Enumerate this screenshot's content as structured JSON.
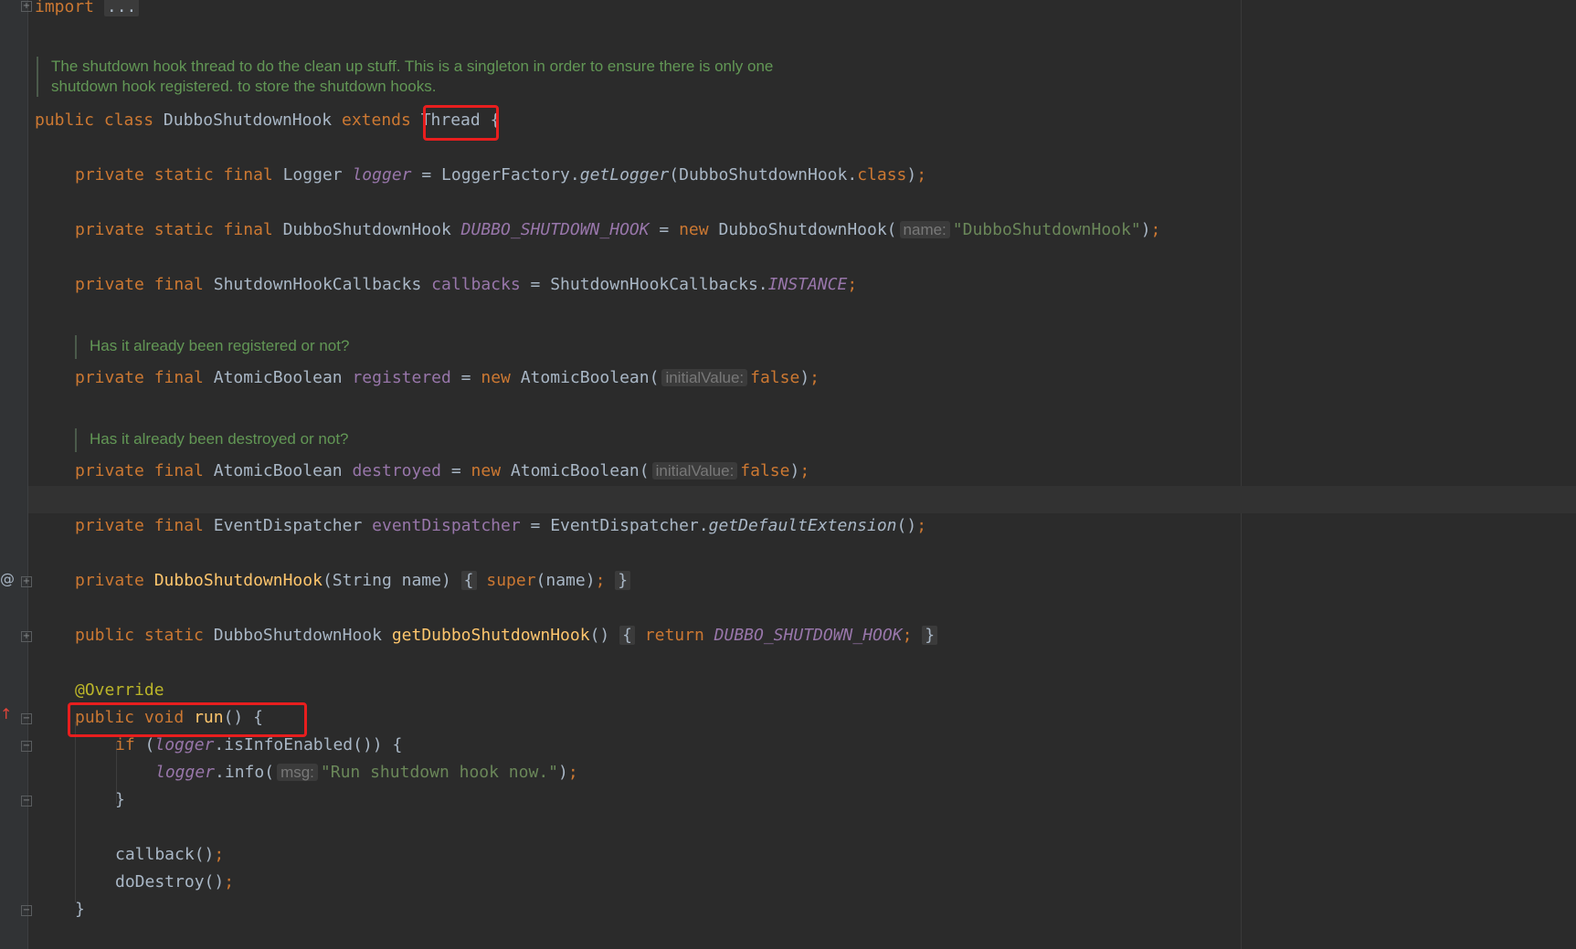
{
  "editor": {
    "import_line": {
      "keyword": "import",
      "folded": "..."
    },
    "class_doc": [
      "The shutdown hook thread to do the clean up stuff. This is a singleton in order to ensure there is only one",
      "shutdown hook registered. to store the shutdown hooks."
    ],
    "class_decl": {
      "mod1": "public",
      "mod2": "class",
      "name": "DubboShutdownHook",
      "extends": "extends",
      "parent": "Thread",
      "brace": "{"
    },
    "logger_line": {
      "mods": "private static final",
      "type": "Logger",
      "field": "logger",
      "eq": " = ",
      "factory": "LoggerFactory.",
      "method": "getLogger",
      "args_open": "(DubboShutdownHook.",
      "cls": "class",
      "close": ")",
      "semi": ";"
    },
    "hook_line": {
      "mods": "private static final",
      "type": "DubboShutdownHook",
      "field": "DUBBO_SHUTDOWN_HOOK",
      "eq": " = ",
      "new": "new",
      "ctor": "DubboShutdownHook(",
      "hint": "name:",
      "arg": "\"DubboShutdownHook\"",
      "close": ")",
      "semi": ";"
    },
    "callbacks_line": {
      "mods": "private final",
      "type": "ShutdownHookCallbacks",
      "field": "callbacks",
      "eq": " = ",
      "cls": "ShutdownHookCallbacks.",
      "const": "INSTANCE",
      "semi": ";"
    },
    "registered_doc": "Has it already been registered or not?",
    "registered_line": {
      "mods": "private final",
      "type": "AtomicBoolean",
      "field": "registered",
      "eq": " = ",
      "new": "new",
      "ctor": "AtomicBoolean(",
      "hint": "initialValue:",
      "arg": "false",
      "close": ")",
      "semi": ";"
    },
    "destroyed_doc": "Has it already been destroyed or not?",
    "destroyed_line": {
      "mods": "private final",
      "type": "AtomicBoolean",
      "field": "destroyed",
      "eq": " = ",
      "new": "new",
      "ctor": "AtomicBoolean(",
      "hint": "initialValue:",
      "arg": "false",
      "close": ")",
      "semi": ";"
    },
    "dispatcher_line": {
      "mods": "private final",
      "type": "EventDispatcher",
      "field": "eventDispatcher",
      "eq": " = ",
      "cls": "EventDispatcher.",
      "method": "getDefaultExtension",
      "parens": "()",
      "semi": ";"
    },
    "ctor_line": {
      "mod": "private",
      "name": "DubboShutdownHook",
      "params": "(String name)",
      "fold_open": "{",
      "super": "super",
      "args": "(name)",
      "semi": ";",
      "fold_close": "}"
    },
    "getter_line": {
      "mods": "public static",
      "type": "DubboShutdownHook",
      "name": "getDubboShutdownHook",
      "parens": "()",
      "fold_open": "{",
      "ret": "return",
      "const": "DUBBO_SHUTDOWN_HOOK",
      "semi": ";",
      "fold_close": "}"
    },
    "override": "@Override",
    "run_line": {
      "mods": "public void",
      "name": "run",
      "rest": "() {"
    },
    "if_line": {
      "kw": "if",
      "open": " (",
      "field": "logger",
      "rest": ".isInfoEnabled()) {"
    },
    "log_line": {
      "field": "logger",
      "call": ".info(",
      "hint": "msg:",
      "arg": "\"Run shutdown hook now.\"",
      "close": ")",
      "semi": ";"
    },
    "close_if": "}",
    "callback_line": {
      "call": "callback()",
      "semi": ";"
    },
    "destroy_line": {
      "call": "doDestroy()",
      "semi": ";"
    },
    "close_run": "}"
  },
  "colors": {
    "background": "#2b2b2b",
    "keyword": "#cc7832",
    "field": "#9876aa",
    "method": "#ffc66d",
    "string": "#6a8759",
    "annotation": "#bbb529",
    "doc_comment": "#629755",
    "highlight_box": "#e81e1e"
  },
  "gutter_icons": {
    "override_marker": "at-sign-icon",
    "implements_marker": "up-arrow-icon"
  }
}
